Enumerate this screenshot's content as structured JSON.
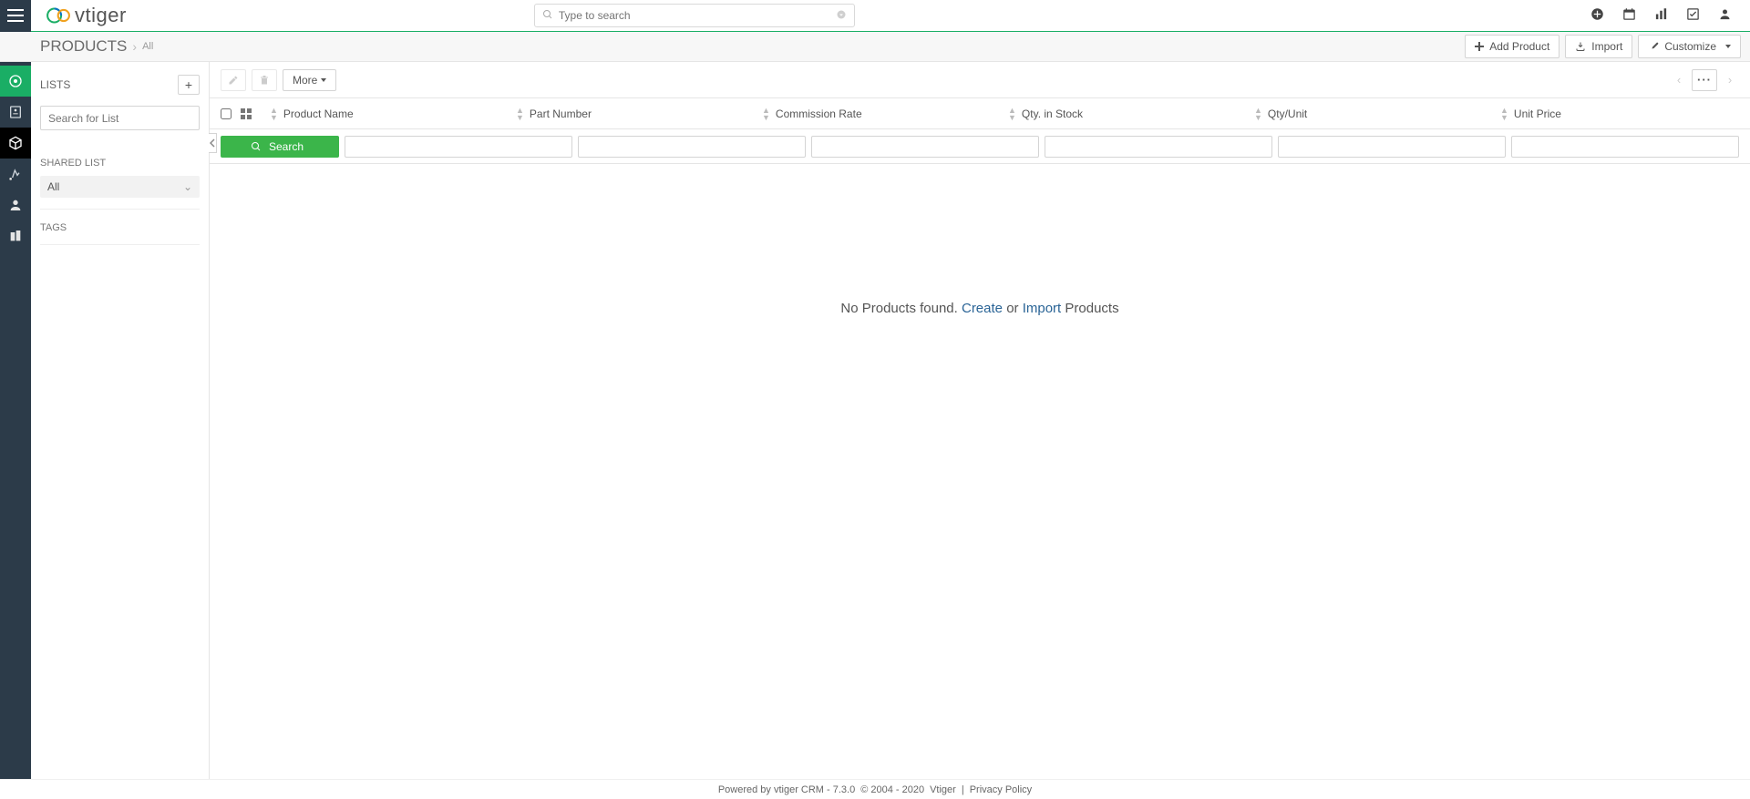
{
  "brand": {
    "name": "vtiger"
  },
  "search": {
    "placeholder": "Type to search"
  },
  "breadcrumb": {
    "module": "PRODUCTS",
    "view": "All"
  },
  "actions": {
    "add_product": "Add Product",
    "import": "Import",
    "customize": "Customize"
  },
  "sidebar": {
    "lists_label": "LISTS",
    "search_placeholder": "Search for List",
    "shared_label": "SHARED LIST",
    "shared_items": [
      {
        "label": "All"
      }
    ],
    "tags_label": "TAGS"
  },
  "toolbar": {
    "more_label": "More"
  },
  "columns": [
    {
      "key": "product_name",
      "label": "Product Name"
    },
    {
      "key": "part_number",
      "label": "Part Number"
    },
    {
      "key": "commission_rate",
      "label": "Commission Rate"
    },
    {
      "key": "qty_in_stock",
      "label": "Qty. in Stock"
    },
    {
      "key": "qty_per_unit",
      "label": "Qty/Unit"
    },
    {
      "key": "unit_price",
      "label": "Unit Price"
    }
  ],
  "filter": {
    "search_label": "Search"
  },
  "empty_state": {
    "prefix": "No Products found. ",
    "create": "Create",
    "mid": " or ",
    "import": "Import",
    "suffix": " Products"
  },
  "footer": {
    "powered": "Powered by vtiger CRM - 7.3.0",
    "copyright": "© 2004 - 2020",
    "vendor": "Vtiger",
    "sep": "|",
    "privacy": "Privacy Policy"
  },
  "rail_items": [
    {
      "name": "dashboard",
      "active": true
    },
    {
      "name": "contacts-card"
    },
    {
      "name": "products",
      "sel": true
    },
    {
      "name": "opportunities"
    },
    {
      "name": "person"
    },
    {
      "name": "organization"
    }
  ]
}
